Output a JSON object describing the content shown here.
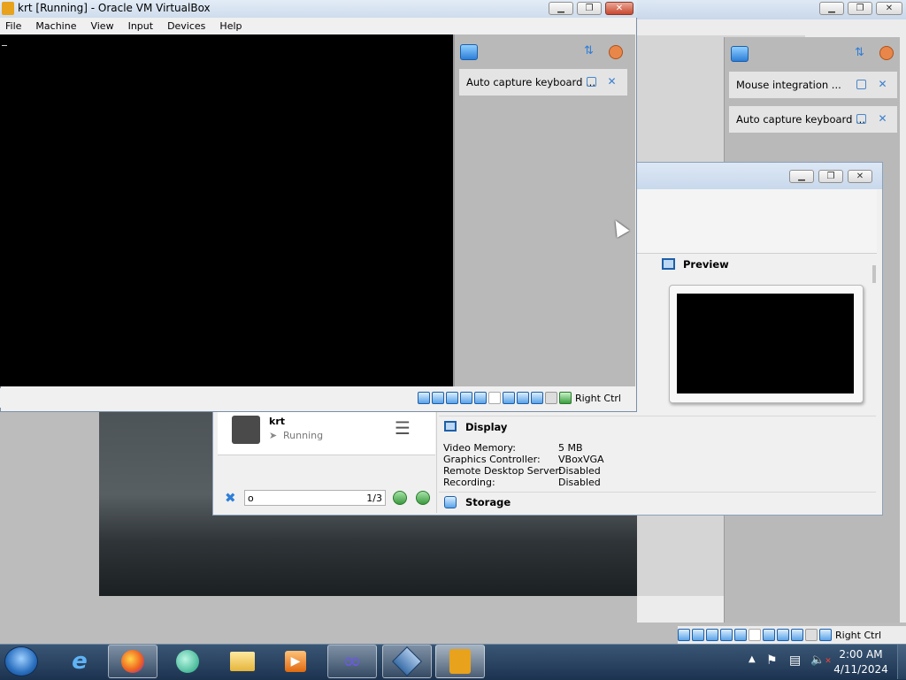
{
  "vm_window": {
    "title": "krt [Running] - Oracle VM VirtualBox",
    "menu": [
      "File",
      "Machine",
      "View",
      "Input",
      "Devices",
      "Help"
    ],
    "notification": {
      "label": "Auto capture keyboard ..."
    },
    "host_key": "Right Ctrl"
  },
  "right_panel": {
    "notifications": [
      {
        "label": "Mouse integration ..."
      },
      {
        "label": "Auto capture keyboard ..."
      }
    ],
    "host_key": "Right Ctrl"
  },
  "manager": {
    "preview_title": "Preview",
    "vm_name": "krt",
    "vm_state": "Running",
    "search_value": "o",
    "search_count": "1/3",
    "display_title": "Display",
    "display_rows": [
      {
        "key": "Video Memory:",
        "value": "5 MB"
      },
      {
        "key": "Graphics Controller:",
        "value": "VBoxVGA"
      },
      {
        "key": "Remote Desktop Server:",
        "value": "Disabled"
      },
      {
        "key": "Recording:",
        "value": "Disabled"
      }
    ],
    "storage_title": "Storage"
  },
  "taskbar": {
    "time": "2:00 AM",
    "date": "4/11/2024"
  },
  "colors": {
    "taskbar": "#1f3b5c",
    "accent": "#2d7ed8",
    "vm_screen": "#000000"
  }
}
